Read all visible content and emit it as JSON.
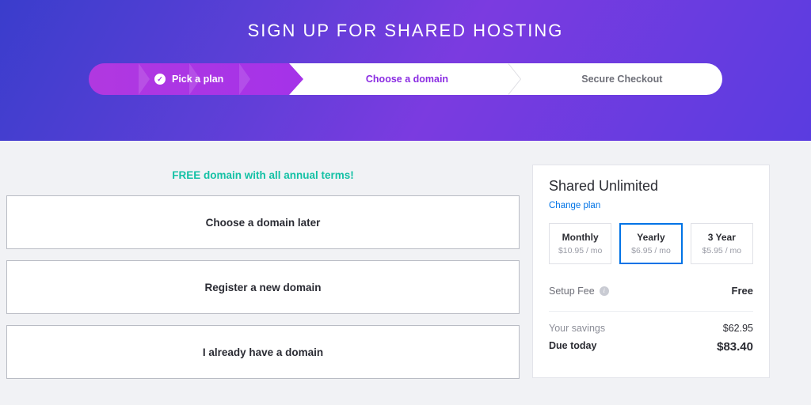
{
  "hero": {
    "title": "SIGN UP FOR SHARED HOSTING"
  },
  "steps": {
    "s1": "Pick a plan",
    "s2": "Choose a domain",
    "s3": "Secure Checkout"
  },
  "promo": "FREE domain with all annual terms!",
  "options": {
    "later": "Choose a domain later",
    "register": "Register a new domain",
    "have": "I already have a domain"
  },
  "plan": {
    "name": "Shared Unlimited",
    "change": "Change plan",
    "terms": {
      "monthly": {
        "label": "Monthly",
        "price": "$10.95 / mo"
      },
      "yearly": {
        "label": "Yearly",
        "price": "$6.95 / mo"
      },
      "three": {
        "label": "3 Year",
        "price": "$5.95 / mo"
      }
    },
    "setup_label": "Setup Fee",
    "setup_value": "Free",
    "savings_label": "Your savings",
    "savings_value": "$62.95",
    "due_label": "Due today",
    "due_value": "$83.40"
  }
}
